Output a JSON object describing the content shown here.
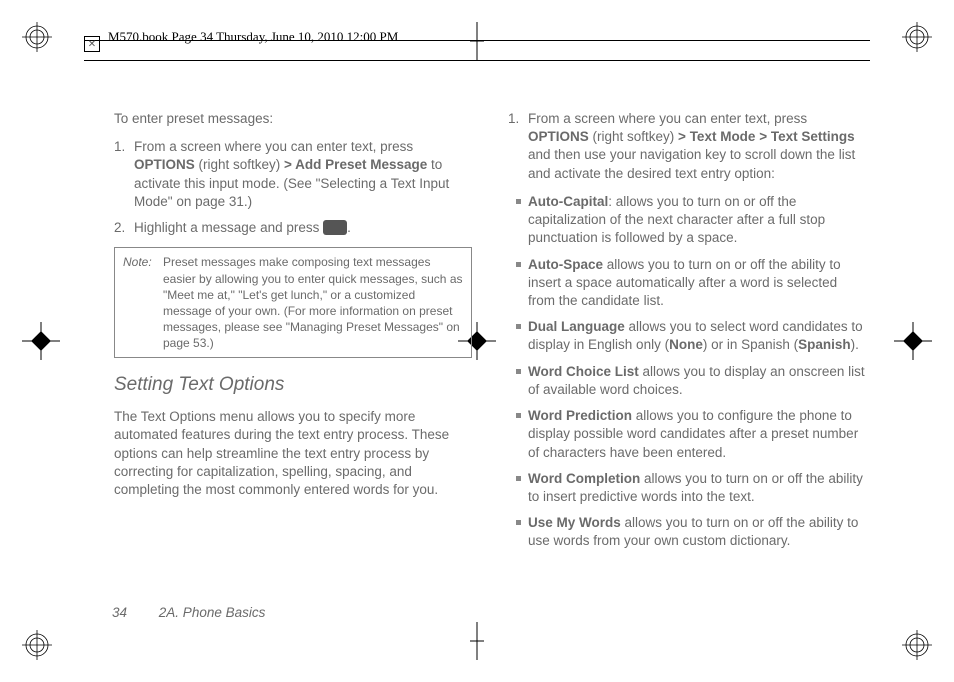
{
  "header": {
    "file_info": "M570.book  Page 34  Thursday, June 10, 2010  12:00 PM",
    "cross_icon": "✕"
  },
  "left": {
    "lead": "To enter preset messages:",
    "step1_num": "1.",
    "step1_a": "From a screen where you can enter text, press ",
    "step1_options": "OPTIONS",
    "step1_b": " (right softkey) ",
    "chev": ">",
    "step1_add_preset": " Add Preset Message",
    "step1_c": " to activate this input mode. (See \"Selecting a Text Input Mode\" on page 31.)",
    "step2_num": "2.",
    "step2_a": "Highlight a message and press ",
    "step2_b": ".",
    "note_label": "Note:",
    "note_body": "Preset messages make composing text messages easier by allowing you to enter quick messages, such as \"Meet me at,\" \"Let's get lunch,\" or a customized message of your own. (For more information on preset messages, please see \"Managing Preset Messages\" on page 53.)",
    "section_heading": "Setting Text Options",
    "section_body": "The Text Options menu allows you to specify more automated features during the text entry process. These options can help streamline the text entry process by correcting for capitalization, spelling, spacing, and completing the most commonly entered words for you."
  },
  "right": {
    "step1_num": "1.",
    "step1_a": "From a screen where you can enter text, press ",
    "step1_options": "OPTIONS",
    "step1_b": " (right softkey) ",
    "chev1": ">",
    "step1_textmode": " Text Mode ",
    "chev2": ">",
    "step1_textsettings": " Text Settings",
    "step1_c": " and then use your navigation key to scroll down the list and activate the desired text entry option:",
    "opts": {
      "auto_capital_label": "Auto-Capital",
      "auto_capital_body": ": allows you to turn on or off the capitalization of the next character after a full stop punctuation is followed by a space.",
      "auto_space_label": "Auto-Space",
      "auto_space_body": " allows you to turn on or off the ability to insert a space automatically after a word is selected from the candidate list.",
      "dual_lang_label": "Dual Language",
      "dual_lang_body_a": " allows you to select word candidates to display in English only (",
      "dual_lang_none": "None",
      "dual_lang_body_b": ") or in Spanish (",
      "dual_lang_spanish": "Spanish",
      "dual_lang_body_c": ").",
      "word_choice_label": "Word Choice List",
      "word_choice_body": " allows you to display an onscreen list of available word choices.",
      "word_pred_label": "Word Prediction",
      "word_pred_body": " allows you to configure the phone to display possible word candidates after a preset number of characters have been entered.",
      "word_comp_label": "Word Completion",
      "word_comp_body": " allows you to turn on or off the ability to insert predictive words into the text.",
      "use_words_label": "Use My Words",
      "use_words_body": " allows you to turn on or off the ability to use words from your own custom dictionary."
    }
  },
  "footer": {
    "page_number": "34",
    "section": "2A. Phone Basics"
  }
}
